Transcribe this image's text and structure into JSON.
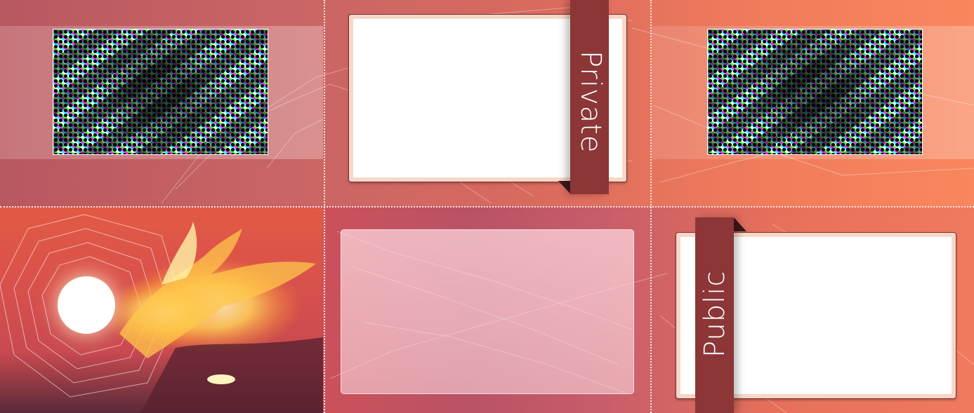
{
  "ribbons": {
    "private_label": "Private",
    "public_label": "Public"
  },
  "panels": [
    {
      "name": "top-left",
      "content": "halftone-photo"
    },
    {
      "name": "top-middle",
      "content": "photo-frame"
    },
    {
      "name": "top-right",
      "content": "halftone-photo"
    },
    {
      "name": "bottom-left",
      "content": "phoenix-sun-artwork"
    },
    {
      "name": "bottom-middle",
      "content": "translucent-panel"
    },
    {
      "name": "bottom-right",
      "content": "photo-frame"
    }
  ],
  "colors": {
    "ribbon": "#8c3637",
    "frame_border": "#f6d8c8",
    "background_left": "#b8585f",
    "background_right": "#f9875d"
  }
}
